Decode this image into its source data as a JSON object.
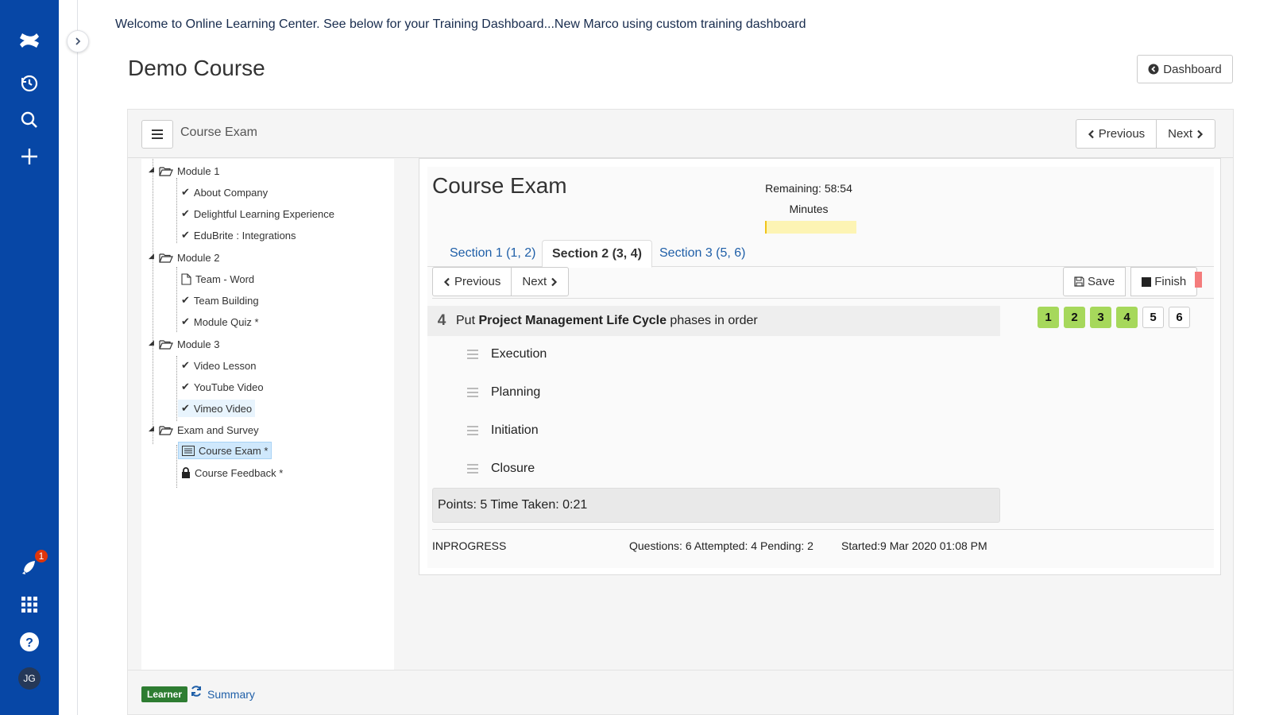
{
  "welcome_text": "Welcome to Online Learning Center. See below for your Training Dashboard...New Marco using custom training dashboard",
  "page_title": "Demo Course",
  "dashboard_btn": "Dashboard",
  "panel": {
    "title": "Course Exam",
    "prev_label": "Previous",
    "next_label": "Next"
  },
  "tree": {
    "modules": [
      {
        "label": "Module 1",
        "items": [
          "About Company",
          "Delightful Learning Experience",
          "EduBrite : Integrations"
        ]
      },
      {
        "label": "Module 2",
        "items": [
          "Team - Word",
          "Team Building",
          "Module Quiz *"
        ]
      },
      {
        "label": "Module 3",
        "items": [
          "Video Lesson",
          "YouTube Video",
          "Vimeo Video"
        ]
      },
      {
        "label": "Exam and Survey",
        "items": [
          "Course Exam *",
          "Course Feedback *"
        ]
      }
    ]
  },
  "exam": {
    "title": "Course Exam",
    "remaining_line1": "Remaining: 58:54",
    "remaining_line2": "Minutes",
    "time_used_fraction": 0.02,
    "tabs": [
      "Section 1 (1, 2)",
      "Section 2 (3, 4)",
      "Section 3 (5, 6)"
    ],
    "prev_label": "Previous",
    "next_label": "Next",
    "save_label": "Save",
    "finish_label": "Finish",
    "question": {
      "number": "4",
      "pre": "Put ",
      "bold": "Project Management Life Cycle",
      "post": " phases in order",
      "options": [
        "Execution",
        "Planning",
        "Initiation",
        "Closure"
      ]
    },
    "question_nav": [
      "1",
      "2",
      "3",
      "4",
      "5",
      "6"
    ],
    "points_line": "Points: 5 Time Taken: 0:21",
    "status": "INPROGRESS",
    "counts": "Questions: 6 Attempted: 4 Pending: 2",
    "started": "Started:9 Mar 2020 01:08 PM"
  },
  "footer": {
    "learner_badge": "Learner",
    "summary_link": "Summary"
  },
  "nav": {
    "notification_count": "1",
    "avatar_initials": "JG"
  },
  "colors": {
    "brand": "#0747a6",
    "done_question": "#a6d85b",
    "learner_badge": "#2e7d32",
    "link": "#1f5fa8"
  }
}
